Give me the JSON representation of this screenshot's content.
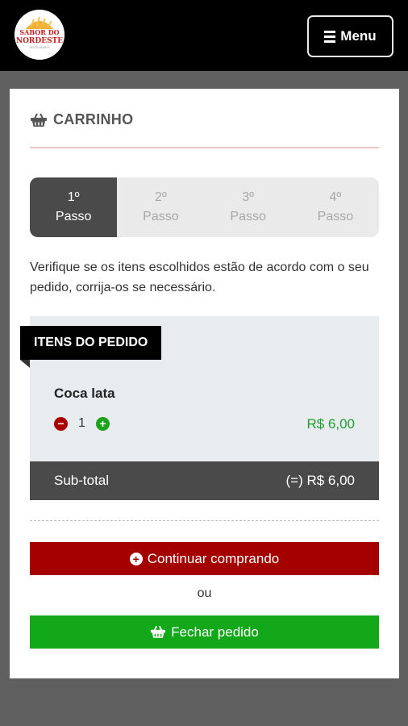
{
  "header": {
    "logo_line1": "SABOR DO",
    "logo_line2": "NORDESTE",
    "logo_line3": "RESTAURANTE",
    "menu_label": "Menu"
  },
  "cart": {
    "title": "CARRINHO",
    "steps": [
      {
        "num": "1º",
        "label": "Passo",
        "active": true
      },
      {
        "num": "2º",
        "label": "Passo",
        "active": false
      },
      {
        "num": "3º",
        "label": "Passo",
        "active": false
      },
      {
        "num": "4º",
        "label": "Passo",
        "active": false
      }
    ],
    "instructions": "Verifique se os itens escolhidos estão de acordo com o seu pedido, corrija-os se necessário.",
    "order_heading": "ITENS DO PEDIDO",
    "items": [
      {
        "name": "Coca lata",
        "quantity": "1",
        "price": "R$ 6,00"
      }
    ],
    "subtotal_label": "Sub-total",
    "subtotal_value": "(=) R$ 6,00",
    "continue_label": "Continuar comprando",
    "or_label": "ou",
    "close_label": "Fechar pedido"
  },
  "colors": {
    "red": "#a50000",
    "green": "#12a81a",
    "dark": "#4a4a4a",
    "price_green": "#1e9e2e"
  },
  "icons": [
    "hamburger-icon",
    "basket-icon",
    "minus-circle-icon",
    "plus-circle-icon"
  ]
}
